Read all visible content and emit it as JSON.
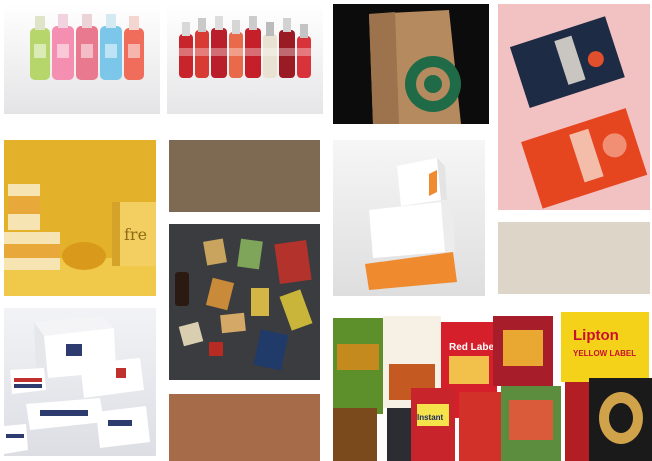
{
  "gallery": {
    "tiles": [
      {
        "id": "juice-bottles",
        "label": ""
      },
      {
        "id": "soda-bottles",
        "label": ""
      },
      {
        "id": "coffee-paper-bag",
        "label": ""
      },
      {
        "id": "snack-pouches",
        "label": ""
      },
      {
        "id": "yellow-jars",
        "label": "fre"
      },
      {
        "id": "brown-swatch",
        "label": ""
      },
      {
        "id": "white-orange-boxes",
        "label": ""
      },
      {
        "id": "snack-flatlay",
        "label": ""
      },
      {
        "id": "beige-swatch",
        "label": ""
      },
      {
        "id": "shipping-boxes",
        "label": ""
      },
      {
        "id": "grocery-products",
        "label": ""
      },
      {
        "id": "copper-swatch",
        "label": ""
      }
    ],
    "brand_texts": {
      "jar_label": "fre",
      "tea_box_brand": "Lipton",
      "tea_box_sub": "YELLOW LABEL",
      "red_pack": "Red Label",
      "mid_can": "Instant"
    },
    "colors": {
      "swatch_brown": "#7e6a52",
      "swatch_beige": "#ddd5c8",
      "swatch_copper": "#a66b48",
      "mustard": "#e4b12a",
      "dark_slate": "#3b3c40",
      "blush": "#f2c2c3"
    }
  }
}
